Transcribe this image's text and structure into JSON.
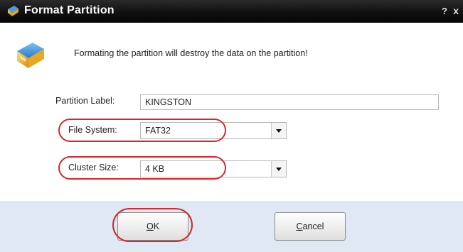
{
  "window": {
    "title": "Format Partition",
    "help_glyph": "?",
    "close_glyph": "x"
  },
  "message": "Formating the partition will destroy the data on the partition!",
  "fields": {
    "partition_label": {
      "label": "Partition Label:",
      "value": "KINGSTON"
    },
    "file_system": {
      "label": "File System:",
      "value": "FAT32"
    },
    "cluster_size": {
      "label": "Cluster Size:",
      "value": "4 KB"
    }
  },
  "buttons": {
    "ok": {
      "mnemonic": "O",
      "rest": "K"
    },
    "cancel": {
      "mnemonic": "C",
      "rest": "ancel"
    }
  },
  "colors": {
    "titlebar": "#111111",
    "highlight": "#d9262b",
    "footer": "#dfe8f3"
  },
  "icons": {
    "title": "disk-tool-icon",
    "dialog": "disk-tool-icon",
    "dropdown": "chevron-down-icon"
  }
}
